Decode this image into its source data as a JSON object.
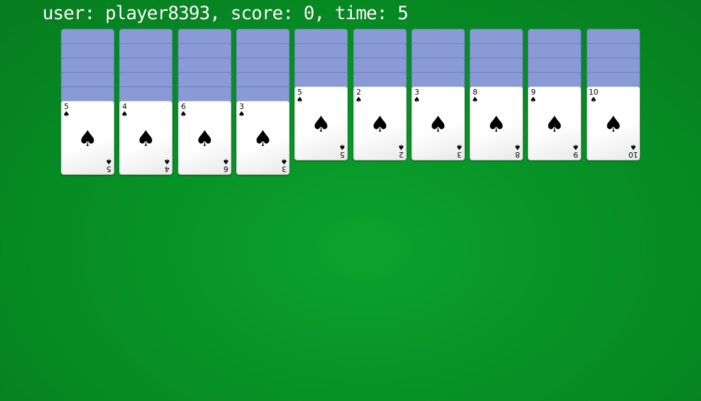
{
  "status": {
    "text": "user: player8393, score: 0, time: 5"
  },
  "suit_symbol": "♠",
  "colors": {
    "felt": "#079326",
    "card_back": "#8a9ad6",
    "card_face": "#ffffff"
  },
  "piles": [
    {
      "hidden": 5,
      "visible": [
        {
          "rank": "5",
          "suit": "spade-icon"
        }
      ]
    },
    {
      "hidden": 5,
      "visible": [
        {
          "rank": "4",
          "suit": "spade-icon"
        }
      ]
    },
    {
      "hidden": 5,
      "visible": [
        {
          "rank": "6",
          "suit": "spade-icon"
        }
      ]
    },
    {
      "hidden": 5,
      "visible": [
        {
          "rank": "3",
          "suit": "spade-icon"
        }
      ]
    },
    {
      "hidden": 4,
      "visible": [
        {
          "rank": "5",
          "suit": "spade-icon"
        }
      ]
    },
    {
      "hidden": 4,
      "visible": [
        {
          "rank": "2",
          "suit": "spade-icon"
        }
      ]
    },
    {
      "hidden": 4,
      "visible": [
        {
          "rank": "3",
          "suit": "spade-icon"
        }
      ]
    },
    {
      "hidden": 4,
      "visible": [
        {
          "rank": "8",
          "suit": "spade-icon"
        }
      ]
    },
    {
      "hidden": 4,
      "visible": [
        {
          "rank": "9",
          "suit": "spade-icon"
        }
      ]
    },
    {
      "hidden": 4,
      "visible": [
        {
          "rank": "10",
          "suit": "spade-icon"
        }
      ]
    }
  ]
}
